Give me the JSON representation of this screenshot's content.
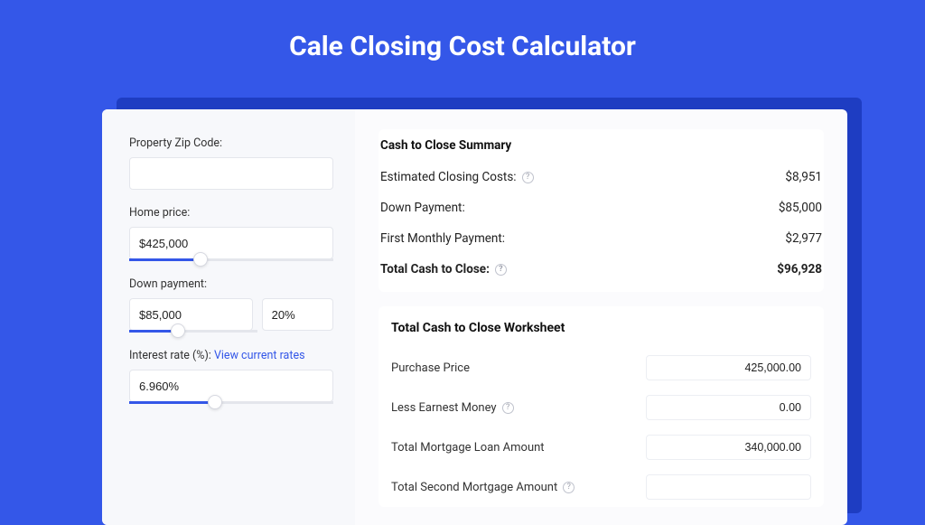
{
  "title": "Cale Closing Cost Calculator",
  "sidebar": {
    "zip_label": "Property Zip Code:",
    "zip_value": "",
    "home_price_label": "Home price:",
    "home_price_value": "$425,000",
    "home_price_slider_pct": 35,
    "down_payment_label": "Down payment:",
    "down_payment_value": "$85,000",
    "down_payment_pct_value": "20%",
    "down_payment_slider_pct": 38,
    "interest_label": "Interest rate (%): ",
    "interest_link": "View current rates",
    "interest_value": "6.960%",
    "interest_slider_pct": 42
  },
  "summary": {
    "heading": "Cash to Close Summary",
    "rows": [
      {
        "label": "Estimated Closing Costs:",
        "help": true,
        "value": "$8,951",
        "bold": false
      },
      {
        "label": "Down Payment:",
        "help": false,
        "value": "$85,000",
        "bold": false
      },
      {
        "label": "First Monthly Payment:",
        "help": false,
        "value": "$2,977",
        "bold": false
      },
      {
        "label": "Total Cash to Close:",
        "help": true,
        "value": "$96,928",
        "bold": true
      }
    ]
  },
  "worksheet": {
    "heading": "Total Cash to Close Worksheet",
    "rows": [
      {
        "label": "Purchase Price",
        "help": false,
        "value": "425,000.00"
      },
      {
        "label": "Less Earnest Money",
        "help": true,
        "value": "0.00"
      },
      {
        "label": "Total Mortgage Loan Amount",
        "help": false,
        "value": "340,000.00"
      },
      {
        "label": "Total Second Mortgage Amount",
        "help": true,
        "value": ""
      }
    ]
  }
}
